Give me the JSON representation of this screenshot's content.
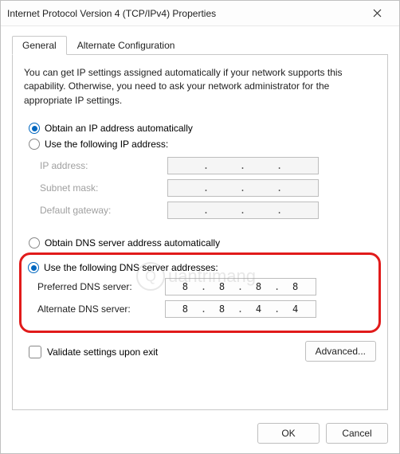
{
  "window": {
    "title": "Internet Protocol Version 4 (TCP/IPv4) Properties"
  },
  "tabs": {
    "general": "General",
    "alternate": "Alternate Configuration"
  },
  "description": "You can get IP settings assigned automatically if your network supports this capability. Otherwise, you need to ask your network administrator for the appropriate IP settings.",
  "ip_section": {
    "auto_label": "Obtain an IP address automatically",
    "manual_label": "Use the following IP address:",
    "fields": {
      "ip_address": {
        "label": "IP address:",
        "value": [
          "",
          "",
          "",
          ""
        ]
      },
      "subnet_mask": {
        "label": "Subnet mask:",
        "value": [
          "",
          "",
          "",
          ""
        ]
      },
      "gateway": {
        "label": "Default gateway:",
        "value": [
          "",
          "",
          "",
          ""
        ]
      }
    }
  },
  "dns_section": {
    "auto_label": "Obtain DNS server address automatically",
    "manual_label": "Use the following DNS server addresses:",
    "fields": {
      "preferred": {
        "label": "Preferred DNS server:",
        "value": [
          "8",
          "8",
          "8",
          "8"
        ]
      },
      "alternate": {
        "label": "Alternate DNS server:",
        "value": [
          "8",
          "8",
          "4",
          "4"
        ]
      }
    }
  },
  "validate_label": "Validate settings upon exit",
  "advanced_label": "Advanced...",
  "ok_label": "OK",
  "cancel_label": "Cancel",
  "watermark": "uantrimang"
}
